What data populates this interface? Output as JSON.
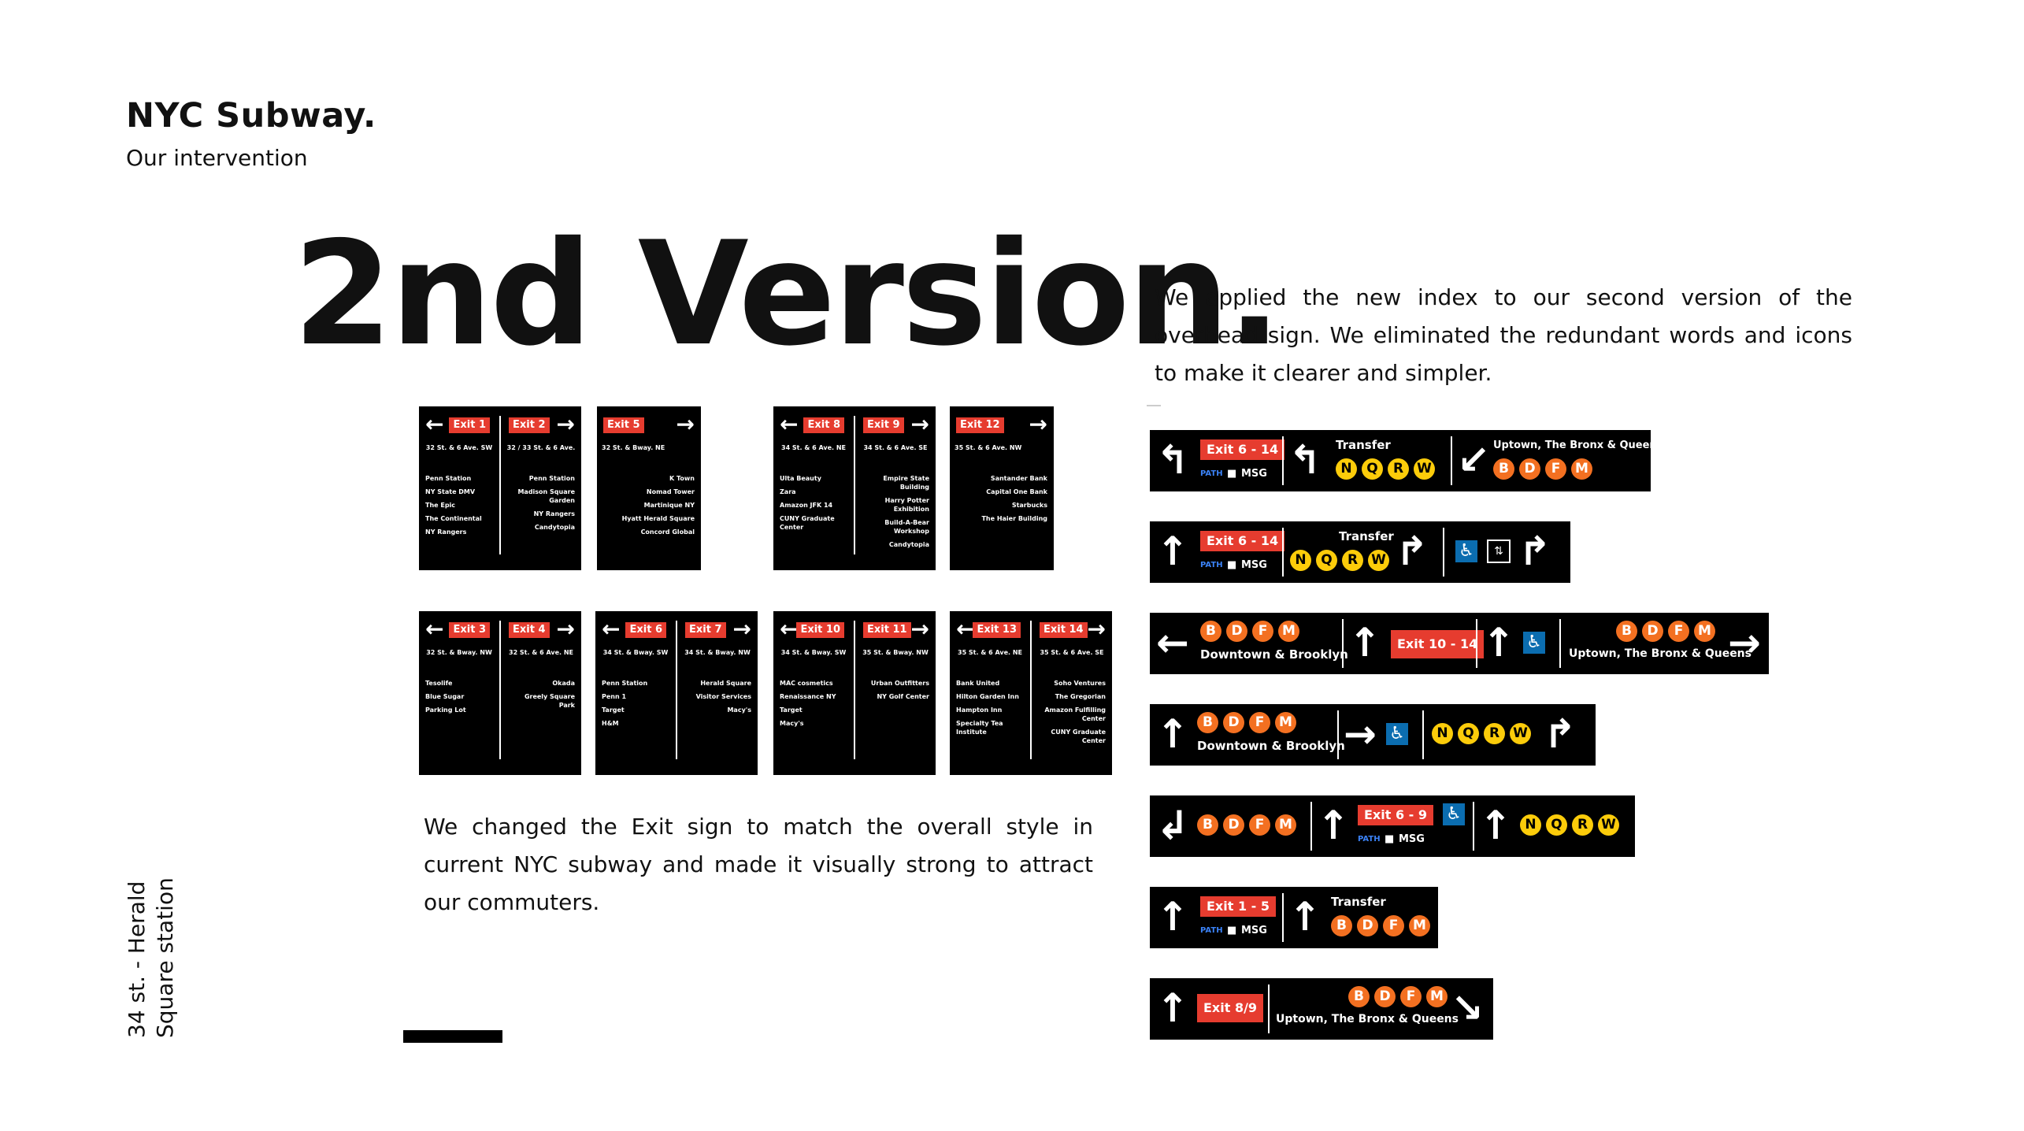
{
  "header": {
    "title": "NYC Subway.",
    "subtitle": "Our intervention"
  },
  "headline": "2nd Version.",
  "para_right": "We applied the new index to our second version of the overhead sign. We eliminated the redundant words and icons to make it clearer and simpler.",
  "para_left": "We changed the Exit sign to match the overall style in current NYC subway and made it visually strong to attract our commuters.",
  "side_label": "34 st. - Herald Square station",
  "panels": [
    {
      "left": {
        "exit": "Exit 1",
        "street": "32 St. & 6 Ave. SW",
        "dests": [
          "Penn Station",
          "NY State DMV",
          "The Epic",
          "The Continental",
          "NY Rangers"
        ]
      },
      "right": {
        "exit": "Exit 2",
        "street": "32 / 33 St. & 6 Ave.",
        "dests": [
          "Penn Station",
          "Madison Square Garden",
          "NY Rangers",
          "Candytopia"
        ]
      }
    },
    {
      "single": {
        "exit": "Exit 5",
        "street": "32 St. & Bway. NE",
        "dests": [
          "K Town",
          "Nomad Tower",
          "Martinique NY",
          "Hyatt Herald Square",
          "Concord Global"
        ]
      }
    },
    {
      "left": {
        "exit": "Exit 8",
        "street": "34 St. & 6 Ave. NE",
        "dests": [
          "Ulta Beauty",
          "Zara",
          "Amazon JFK 14",
          "CUNY Graduate Center"
        ]
      },
      "right": {
        "exit": "Exit 9",
        "street": "34 St. & 6 Ave. SE",
        "dests": [
          "Empire State Building",
          "Harry Potter Exhibition",
          "Build-A-Bear Workshop",
          "Candytopia"
        ]
      }
    },
    {
      "single": {
        "exit": "Exit 12",
        "street": "35 St. & 6 Ave. NW",
        "dests": [
          "Santander Bank",
          "Capital One Bank",
          "Starbucks",
          "The Haier Building"
        ]
      }
    },
    {
      "left": {
        "exit": "Exit 3",
        "street": "32 St. & Bway. NW",
        "dests": [
          "Tesolife",
          "Blue Sugar",
          "Parking Lot"
        ]
      },
      "right": {
        "exit": "Exit 4",
        "street": "32 St. & 6 Ave. NE",
        "dests": [
          "Okada",
          "Greely Square Park"
        ]
      }
    },
    {
      "left": {
        "exit": "Exit 6",
        "street": "34 St. & Bway. SW",
        "dests": [
          "Penn Station",
          "Penn 1",
          "Target",
          "H&M"
        ]
      },
      "right": {
        "exit": "Exit 7",
        "street": "34 St. & Bway. NW",
        "dests": [
          "Herald Square",
          "Visitor Services",
          "Macy's"
        ]
      }
    },
    {
      "left": {
        "exit": "Exit 10",
        "street": "34 St. & Bway. SW",
        "dests": [
          "MAC cosmetics",
          "Renaissance NY",
          "Target",
          "Macy's"
        ]
      },
      "right": {
        "exit": "Exit 11",
        "street": "35 St. & Bway. NW",
        "dests": [
          "Urban Outfitters",
          "NY Golf Center"
        ]
      }
    },
    {
      "left": {
        "exit": "Exit 13",
        "street": "35 St. & 6 Ave. NE",
        "dests": [
          "Bank United",
          "Hilton Garden Inn",
          "Hampton Inn",
          "Specialty Tea Institute"
        ]
      },
      "right": {
        "exit": "Exit 14",
        "street": "35 St. & 6 Ave. SE",
        "dests": [
          "Soho Ventures",
          "The Gregorian",
          "Amazon Fulfilling Center",
          "CUNY Graduate Center"
        ]
      }
    }
  ],
  "signs": {
    "s1": {
      "exit": "Exit 6 - 14",
      "msg": "MSG",
      "transfer": "Transfer",
      "dest": "Uptown, The Bronx & Queens"
    },
    "s2": {
      "exit": "Exit 6 - 14",
      "msg": "MSG",
      "transfer": "Transfer"
    },
    "s3": {
      "dest_left": "Downtown & Brooklyn",
      "exit": "Exit 10 - 14",
      "dest_right": "Uptown, The Bronx & Queens"
    },
    "s4": {
      "dest": "Downtown & Brooklyn"
    },
    "s5": {
      "exit": "Exit 6 - 9",
      "msg": "MSG"
    },
    "s6": {
      "exit": "Exit 1 - 5",
      "msg": "MSG",
      "transfer": "Transfer"
    },
    "s7": {
      "exit": "Exit 8/9",
      "dest": "Uptown, The Bronx & Queens"
    }
  },
  "icons": {
    "path": "PATH",
    "msg_icon": "■",
    "accessible": "♿",
    "elevator": "⇅"
  },
  "bullets": {
    "orange": [
      "B",
      "D",
      "F",
      "M"
    ],
    "yellow": [
      "N",
      "Q",
      "R",
      "W"
    ]
  },
  "colors": {
    "exit_red": "#e63c2f",
    "orange_line": "#f37021",
    "yellow_line": "#fccc0a",
    "access_blue": "#0b6db0"
  }
}
